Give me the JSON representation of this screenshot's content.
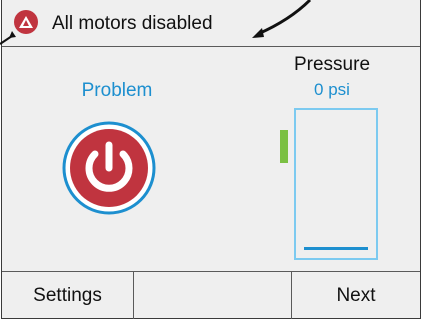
{
  "status": {
    "message": "All motors disabled",
    "alert_icon": "alert-triangle-icon",
    "alert_color": "#c0343f"
  },
  "main": {
    "problem_label": "Problem",
    "power_icon": "power-icon",
    "pressure": {
      "title": "Pressure",
      "value": "0 psi",
      "level": 0
    }
  },
  "softkeys": {
    "left": "Settings",
    "middle": "",
    "right": "Next"
  },
  "colors": {
    "accent": "#1d8fcf",
    "gauge_border": "#7ccaf0",
    "marker": "#7bc043",
    "power_button": "#c0343f"
  }
}
